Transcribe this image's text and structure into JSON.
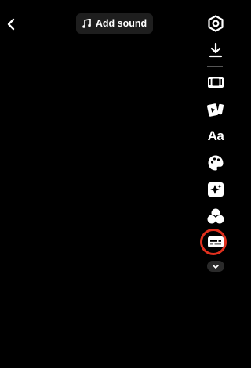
{
  "header": {
    "back_icon": "chevron-left-icon",
    "add_sound_label": "Add sound",
    "add_sound_icon": "music-note-icon"
  },
  "toolbar": {
    "items": [
      {
        "name": "settings",
        "icon": "gear-icon"
      },
      {
        "name": "download",
        "icon": "download-icon"
      },
      {
        "name": "adjust-clips",
        "icon": "film-frame-icon"
      },
      {
        "name": "templates",
        "icon": "template-cards-icon"
      },
      {
        "name": "text",
        "icon": "text-icon",
        "label": "Aa"
      },
      {
        "name": "stickers",
        "icon": "sticker-palette-icon"
      },
      {
        "name": "effects",
        "icon": "sparkle-effects-icon"
      },
      {
        "name": "filters",
        "icon": "filter-circles-icon"
      },
      {
        "name": "captions",
        "icon": "captions-icon",
        "highlighted": true
      },
      {
        "name": "more",
        "icon": "chevron-down-icon"
      }
    ]
  },
  "colors": {
    "background": "#000000",
    "highlight": "#e0301e",
    "pill": "#1e1e1e"
  }
}
